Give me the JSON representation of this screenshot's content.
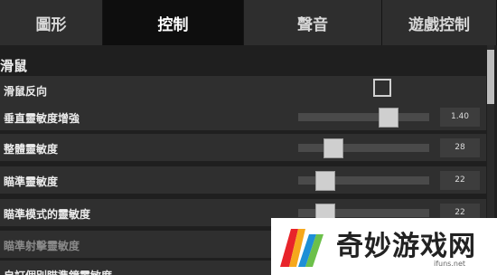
{
  "tabs": [
    {
      "label": "圖形",
      "active": false
    },
    {
      "label": "控制",
      "active": true
    },
    {
      "label": "聲音",
      "active": false
    },
    {
      "label": "遊戲控制",
      "active": false
    }
  ],
  "section": {
    "title": "滑鼠"
  },
  "rows": [
    {
      "label": "滑鼠反向",
      "type": "checkbox",
      "checked": false
    },
    {
      "label": "垂直靈敏度增強",
      "type": "slider",
      "value": "1.40",
      "fraction": 0.69
    },
    {
      "label": "整體靈敏度",
      "type": "slider",
      "value": "28",
      "fraction": 0.27
    },
    {
      "label": "瞄準靈敏度",
      "type": "slider",
      "value": "22",
      "fraction": 0.21
    },
    {
      "label": "瞄準模式的靈敏度",
      "type": "slider",
      "value": "22",
      "fraction": 0.21
    },
    {
      "label": "瞄準射擊靈敏度",
      "type": "slider",
      "dimmed": true
    },
    {
      "label": "自訂個別瞄準鏡靈敏度",
      "type": "text",
      "dimmed": false
    }
  ],
  "watermark": {
    "brand": "奇妙游戏网",
    "url": "ifuns.net"
  },
  "colors": {
    "active_tab": "#0e0e0e",
    "inactive_tab": "#2e2e2e",
    "row_bg": "#2f2f2f",
    "thumb": "#cfcfcf"
  }
}
